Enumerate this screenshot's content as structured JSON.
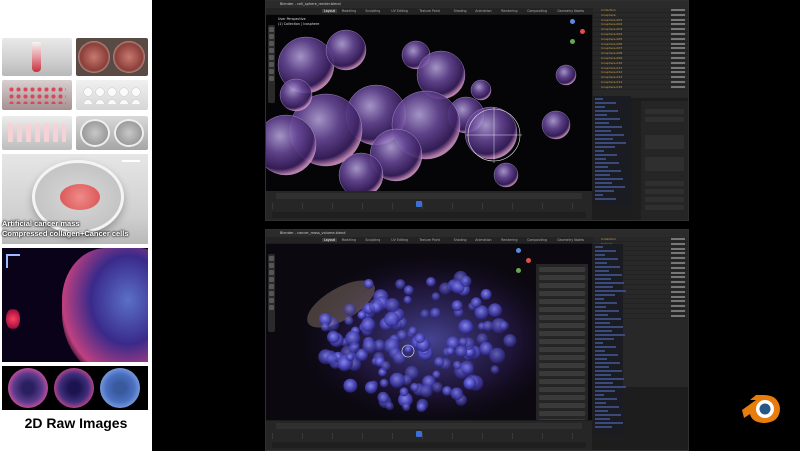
{
  "left_panel": {
    "caption_line1": "Artificial cancer mass",
    "caption_line2": "Compressed collagen+Cancer cells",
    "raw_images_title": "2D Raw Images"
  },
  "window_top": {
    "title": "Blender - cell_sphere_render.blend",
    "tabs": [
      "Layout",
      "Modeling",
      "Sculpting",
      "UV Editing",
      "Texture Paint",
      "Shading",
      "Animation",
      "Rendering",
      "Compositing",
      "Geometry Nodes",
      "Scripting"
    ],
    "viewport_header": "User Perspective",
    "viewport_sub": "(1) Collection | Icosphere",
    "scene_label": "Scene",
    "view_layer_label": "View Layer",
    "outliner_items": [
      "Collection",
      "Icosphere",
      "Icosphere.001",
      "Icosphere.002",
      "Icosphere.003",
      "Icosphere.004",
      "Icosphere.005",
      "Icosphere.006",
      "Icosphere.007",
      "Icosphere.008",
      "Icosphere.009",
      "Icosphere.010",
      "Icosphere.011",
      "Icosphere.012",
      "Icosphere.013",
      "Icosphere.014",
      "Icosphere.015"
    ]
  },
  "window_bottom": {
    "title": "Blender - cancer_mass_volume.blend",
    "tabs": [
      "Layout",
      "Modeling",
      "Sculpting",
      "UV Editing",
      "Texture Paint",
      "Shading",
      "Animation",
      "Rendering",
      "Compositing",
      "Geometry Nodes",
      "Scripting"
    ],
    "scene_label": "Scene",
    "view_layer_label": "View Layer",
    "outliner_items": [
      "Collection",
      "Camera",
      "Light",
      "Volume",
      "Volume.001",
      "Volume.002",
      "Volume.003",
      "Volume.004",
      "Volume.005",
      "Volume.006",
      "Volume.007",
      "Volume.008",
      "Volume.009",
      "Volume.010",
      "Volume.011",
      "Volume.012",
      "Volume.013"
    ]
  },
  "colors": {
    "blender_orange": "#e87d0d",
    "blender_blue": "#265787",
    "active_frame": "#3d6fd9"
  }
}
